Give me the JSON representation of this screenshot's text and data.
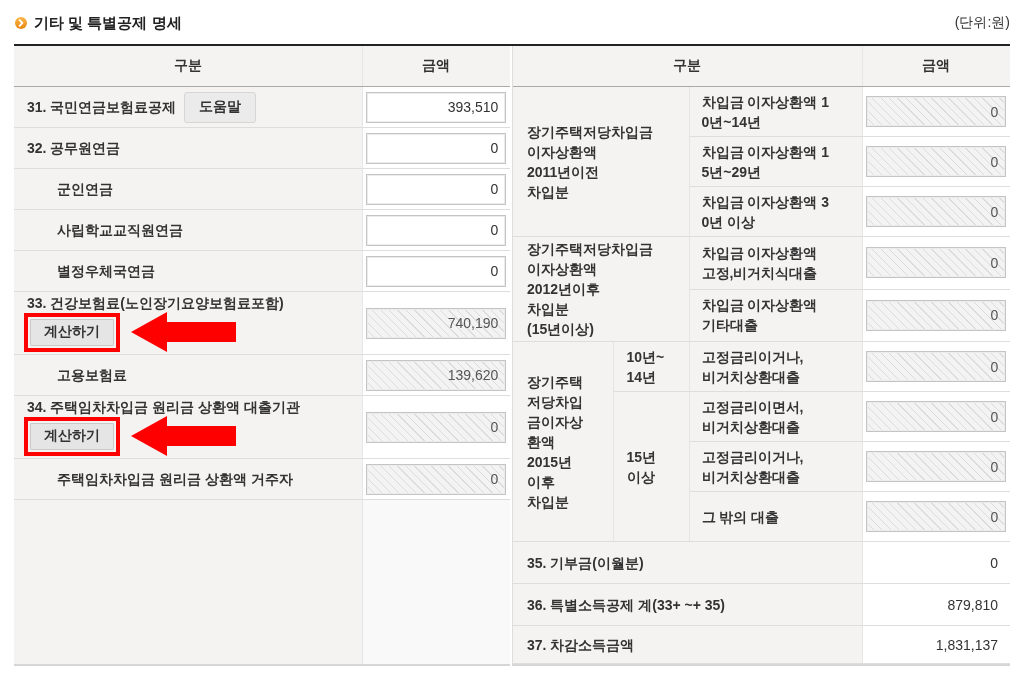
{
  "section": {
    "title": "기타 및 특별공제 명세",
    "unit": "(단위:원)"
  },
  "left_table": {
    "columns": [
      "구분",
      "금액"
    ],
    "rows": [
      {
        "label": "31. 국민연금보험료공제",
        "help_button": "도움말",
        "value": "393,510",
        "readonly": false
      },
      {
        "label": "32. 공무원연금",
        "value": "0",
        "readonly": false,
        "children": [
          {
            "label": "군인연금",
            "value": "0",
            "readonly": false
          },
          {
            "label": "사립학교교직원연금",
            "value": "0",
            "readonly": false
          },
          {
            "label": "별정우체국연금",
            "value": "0",
            "readonly": false
          }
        ]
      },
      {
        "label": "33. 건강보험료(노인장기요양보험료포함)",
        "calc_button": {
          "label": "계산하기",
          "highlighted": true
        },
        "value": "740,190",
        "readonly": true,
        "children": [
          {
            "label": "고용보험료",
            "value": "139,620",
            "readonly": true
          }
        ]
      },
      {
        "label": "34. 주택임차차입금 원리금 상환액 대출기관",
        "calc_button": {
          "label": "계산하기",
          "highlighted": true
        },
        "value": "0",
        "readonly": true,
        "children": [
          {
            "label": "주택임차차입금 원리금 상환액 거주자",
            "value": "0",
            "readonly": true
          }
        ]
      }
    ]
  },
  "right_table": {
    "columns": [
      "구분",
      "금액"
    ],
    "groups": [
      {
        "kind": "flat",
        "label": "장기주택저당차입금\n이자상환액\n2011년이전\n차입분",
        "items": [
          {
            "label": "차입금 이자상환액 1\n0년~14년",
            "value": "0",
            "readonly": true
          },
          {
            "label": "차입금 이자상환액 1\n5년~29년",
            "value": "0",
            "readonly": true
          },
          {
            "label": "차입금 이자상환액 3\n0년 이상",
            "value": "0",
            "readonly": true
          }
        ]
      },
      {
        "kind": "flat",
        "label": "장기주택저당차입금\n이자상환액\n2012년이후\n차입분\n(15년이상)",
        "items": [
          {
            "label": "차입금 이자상환액\n고정,비거치식대출",
            "value": "0",
            "readonly": true
          },
          {
            "label": "차입금 이자상환액\n기타대출",
            "value": "0",
            "readonly": true
          }
        ]
      },
      {
        "kind": "nested",
        "label": "장기주택\n저당차입\n금이자상\n환액\n2015년\n이후\n차입분",
        "subgroups": [
          {
            "label": "10년~\n14년",
            "items": [
              {
                "label": "고정금리이거나,\n비거치상환대출",
                "value": "0",
                "readonly": true
              }
            ]
          },
          {
            "label": "15년\n이상",
            "items": [
              {
                "label": "고정금리이면서,\n비거치상환대출",
                "value": "0",
                "readonly": true
              },
              {
                "label": "고정금리이거나,\n비거치상환대출",
                "value": "0",
                "readonly": true
              },
              {
                "label": "그 밖의 대출",
                "value": "0",
                "readonly": true
              }
            ]
          }
        ]
      }
    ],
    "totals": [
      {
        "label": "35. 기부금(이월분)",
        "value": "0"
      },
      {
        "label": "36. 특별소득공제 계(33+ ~+ 35)",
        "value": "879,810"
      },
      {
        "label": "37. 차감소득금액",
        "value": "1,831,137"
      }
    ]
  }
}
